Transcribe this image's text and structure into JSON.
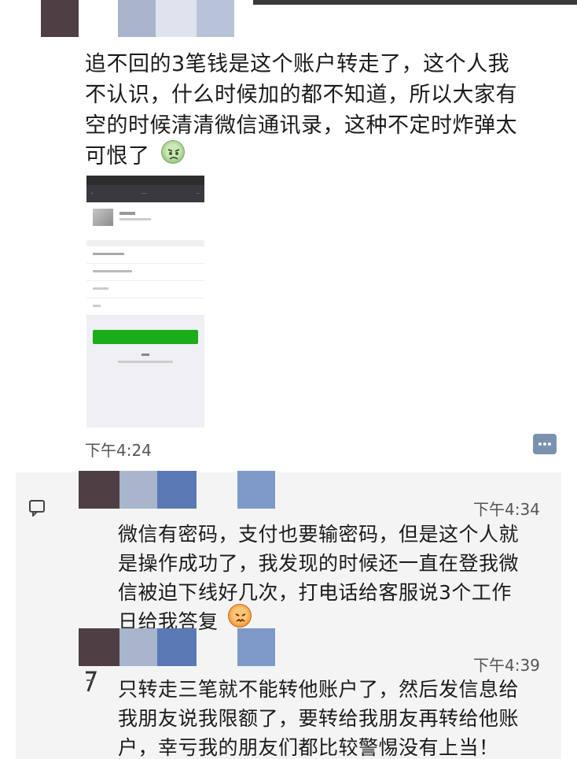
{
  "messages": [
    {
      "text": "追不回的3笔钱是这个账户转走了，这个人我\n不认识，什么时候加的都不知道，所以大家有\n空的时候清清微信通讯录，这种不定时炸弹太\n可恨了",
      "time": "下午4:24",
      "emoji": "angry-face"
    },
    {
      "text": "微信有密码，支付也要输密码，但是这个人就\n是操作成功了，我发现的时候还一直在登我微\n信被迫下线好几次，打电话给客服说3个工作\n日给我答复",
      "time": "下午4:34",
      "emoji": "frustrated-face"
    },
    {
      "text": "只转走三笔就不能转他账户了，然后发信息给\n我朋友说我限额了，要转给我朋友再转给他账\n户，幸亏我的朋友们都比较警惕没有上当！",
      "time": "下午4:39"
    }
  ],
  "icons": {
    "comment": "comment-icon",
    "share": "share-icon"
  },
  "colors": {
    "wechat_green": "#1aad19",
    "panel_bg": "#f4f4f4",
    "mosaic_dark": "#4f3f45",
    "mosaic_light": "#a8b5cc",
    "mosaic_blue": "#5b79b4"
  }
}
